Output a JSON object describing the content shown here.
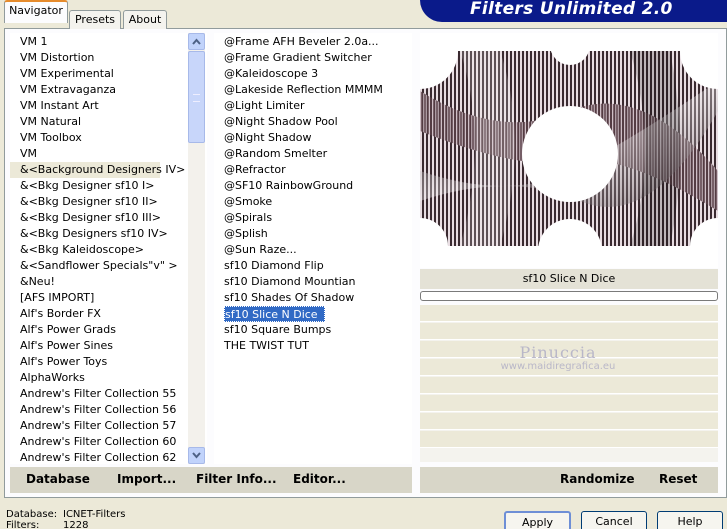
{
  "banner": {
    "title": "Filters Unlimited 2.0"
  },
  "tabs": [
    {
      "label": "Navigator",
      "active": true
    },
    {
      "label": "Presets",
      "active": false
    },
    {
      "label": "About",
      "active": false
    }
  ],
  "categories": [
    "VM 1",
    "VM Distortion",
    "VM Experimental",
    "VM Extravaganza",
    "VM Instant Art",
    "VM Natural",
    "VM Toolbox",
    "VM",
    "&<Background Designers IV>",
    "&<Bkg Designer sf10 I>",
    "&<Bkg Designer sf10 II>",
    "&<Bkg Designer sf10 III>",
    "&<Bkg Designers sf10 IV>",
    "&<Bkg Kaleidoscope>",
    "&<Sandflower Specials\"v\" >",
    "&Neu!",
    "[AFS IMPORT]",
    "Alf's Border FX",
    "Alf's Power Grads",
    "Alf's Power Sines",
    "Alf's Power Toys",
    "AlphaWorks",
    "Andrew's Filter Collection 55",
    "Andrew's Filter Collection 56",
    "Andrew's Filter Collection 57",
    "Andrew's Filter Collection 60",
    "Andrew's Filter Collection 62"
  ],
  "selected_category": "&<Background Designers IV>",
  "filters": [
    "@Frame AFH Beveler 2.0a...",
    "@Frame Gradient Switcher",
    "@Kaleidoscope 3",
    "@Lakeside Reflection MMMM",
    "@Light Limiter",
    "@Night Shadow Pool",
    "@Night Shadow",
    "@Random Smelter",
    "@Refractor",
    "@SF10 RainbowGround",
    "@Smoke",
    "@Spirals",
    "@Splish",
    "@Sun Raze...",
    "sf10 Diamond Flip",
    "sf10 Diamond Mountian",
    "sf10 Shades Of Shadow",
    "sf10 Slice N Dice",
    "sf10 Square Bumps",
    "THE TWIST TUT"
  ],
  "selected_filter": "sf10 Slice N Dice",
  "preview": {
    "filter_name": "sf10 Slice N Dice",
    "watermark_name": "Pinuccia",
    "watermark_url": "www.maidiregrafica.eu"
  },
  "toolbar": {
    "database": "Database",
    "import": "Import...",
    "filter_info": "Filter Info...",
    "editor": "Editor...",
    "randomize": "Randomize",
    "reset": "Reset"
  },
  "footer": {
    "database_label": "Database:",
    "database_value": "ICNET-Filters",
    "filters_label": "Filters:",
    "filters_value": "1228"
  },
  "buttons": {
    "apply": "Apply",
    "cancel": "Cancel",
    "help": "Help"
  },
  "colors": {
    "banner": "#0a1a8a",
    "selection": "#316ac5",
    "active_tab_accent": "#e68b2c"
  }
}
